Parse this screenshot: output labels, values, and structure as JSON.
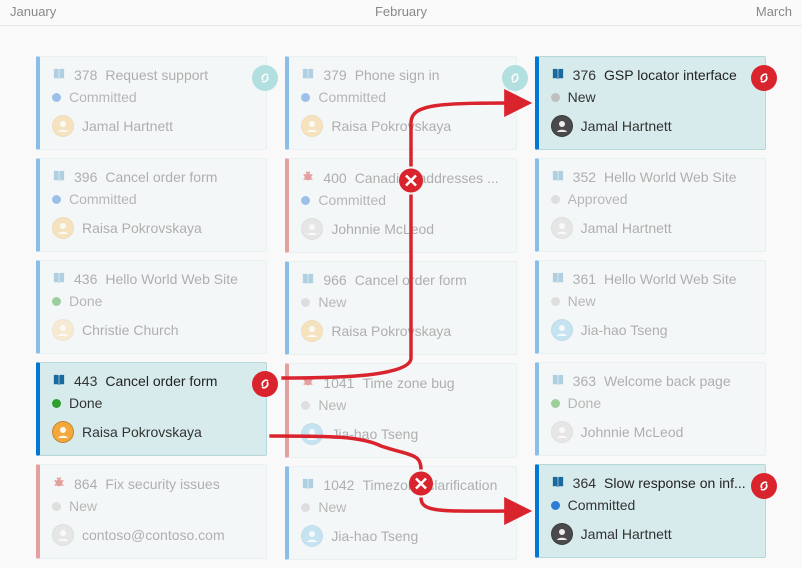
{
  "months": {
    "jan": "January",
    "feb": "February",
    "mar": "March"
  },
  "states": {
    "new": "New",
    "approved": "Approved",
    "committed": "Committed",
    "done": "Done"
  },
  "columns": [
    {
      "cards": [
        {
          "id": 378,
          "type": "feature",
          "title": "Request support",
          "state": "committed",
          "assignee": "Jamal Hartnett",
          "avatarColor": "#f2c97a",
          "badge": "teal"
        },
        {
          "id": 396,
          "type": "feature",
          "title": "Cancel order form",
          "state": "committed",
          "assignee": "Raisa Pokrovskaya",
          "avatarColor": "#f2c97a"
        },
        {
          "id": 436,
          "type": "feature",
          "title": "Hello World Web Site",
          "state": "done",
          "assignee": "Christie Church",
          "avatarColor": "#f5d9a6"
        },
        {
          "id": 443,
          "type": "feature",
          "title": "Cancel order form",
          "state": "done",
          "assignee": "Raisa Pokrovskaya",
          "avatarColor": "#f2a83a",
          "active": true,
          "badge": "red"
        },
        {
          "id": 864,
          "type": "bug",
          "title": "Fix security issues",
          "state": "new",
          "assignee": "contoso@contoso.com",
          "avatarColor": "#d0d0d0"
        }
      ]
    },
    {
      "cards": [
        {
          "id": 379,
          "type": "feature",
          "title": "Phone sign in",
          "state": "committed",
          "assignee": "Raisa Pokrovskaya",
          "avatarColor": "#f2c97a",
          "badge": "teal"
        },
        {
          "id": 400,
          "type": "bug",
          "title": "Canadian addresses ...",
          "state": "committed",
          "assignee": "Johnnie McLeod",
          "avatarColor": "#d0d0d0"
        },
        {
          "id": 966,
          "type": "feature",
          "title": "Cancel order form",
          "state": "new",
          "assignee": "Raisa Pokrovskaya",
          "avatarColor": "#f2c97a"
        },
        {
          "id": 1041,
          "type": "bug",
          "title": "Time zone bug",
          "state": "new",
          "assignee": "Jia-hao Tseng",
          "avatarColor": "#89c9e8"
        },
        {
          "id": 1042,
          "type": "feature",
          "title": "Timezone clarification",
          "state": "new",
          "assignee": "Jia-hao Tseng",
          "avatarColor": "#89c9e8"
        }
      ]
    },
    {
      "cards": [
        {
          "id": 376,
          "type": "feature",
          "title": "GSP locator interface",
          "state": "new",
          "assignee": "Jamal Hartnett",
          "avatarColor": "#4a4a4a",
          "active": true,
          "badge": "red"
        },
        {
          "id": 352,
          "type": "feature",
          "title": "Hello World Web Site",
          "state": "approved",
          "assignee": "Jamal Hartnett",
          "avatarColor": "#d0d0d0"
        },
        {
          "id": 361,
          "type": "feature",
          "title": "Hello World Web Site",
          "state": "new",
          "assignee": "Jia-hao Tseng",
          "avatarColor": "#89c9e8"
        },
        {
          "id": 363,
          "type": "feature",
          "title": "Welcome back page",
          "state": "done",
          "assignee": "Johnnie McLeod",
          "avatarColor": "#d0d0d0"
        },
        {
          "id": 364,
          "type": "feature",
          "title": "Slow response on inf...",
          "state": "committed",
          "assignee": "Jamal Hartnett",
          "avatarColor": "#4a4a4a",
          "active": true,
          "badge": "red"
        }
      ]
    }
  ]
}
